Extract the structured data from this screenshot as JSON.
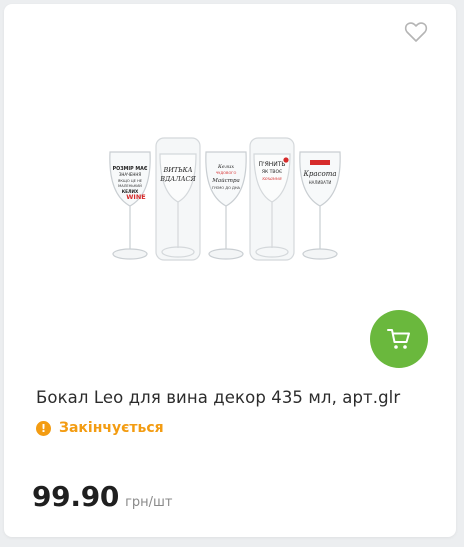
{
  "product": {
    "title": "Бокал Leo для вина декор 435 мл, арт.glr",
    "status": "Закінчується",
    "price": "99.90",
    "unit": "грн/шт",
    "image_captions": {
      "glass1": "Розмір має значення",
      "glass2": "ВИТЬКА ВДАЛАСЯ",
      "glass3": "Келих",
      "glass4": "П'ЯНИТЬ",
      "glass5": "Красота"
    }
  },
  "icons": {
    "favorite": "heart-outline-icon",
    "cart": "shopping-cart-icon",
    "status": "exclamation-icon"
  },
  "colors": {
    "accent_green": "#6ab83d",
    "status_orange": "#f39c12"
  }
}
